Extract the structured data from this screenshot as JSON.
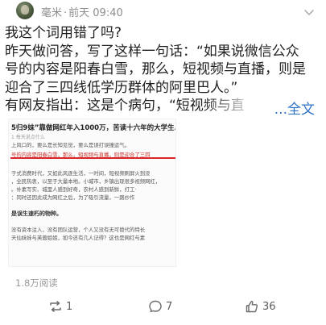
{
  "header": {
    "username": "毫米",
    "separator": "·",
    "time": "前天 09:40",
    "avatar_icon": "avatar"
  },
  "post": {
    "lines": [
      "我这个词用错了吗?",
      "昨天做问答，写了这样一句话：“如果说微信公众",
      "号的内容是阳春白雪，那么，短视频与直播，则是",
      "迎合了三四线低学历群体的阿里巴人。”",
      "有网友指出：这是个病句，“短视频与直"
    ],
    "fulltext_label": "...全文"
  },
  "article_image": {
    "headline": "5归9妹”靠做网红年入1000万，苦读十六年的大学生...",
    "sub": "1 每天说点什么",
    "lines": [
      "上风口的，要么是长知见觉，要么是误打误撞运气。",
      "号的内容是阳春白雪，那么，短视频与直播，则是迎合了三四",
      "于式消费时代，又如此风逐生活，一时间，短视频刷屏火到没",
      "，全民热衷，以至于大量本地。小城市，乡镇出现很多视频网红，",
      "。补素写实、城里人感到好奇，农村人感到新鲜，打工·",
      "：同时还因此成为网红之后，为了吸引流量，一路炒作",
      "是误生速朽的物种。",
      "没有资本注入，没有团队运营，个人又没有无可替代的特长",
      "天仙妹妹与芙蓉姐姐，如今还有几人记得？这也是网红与素"
    ],
    "bold_line": "是误生速朽的物种。"
  },
  "footer": {
    "reads": "1.8万阅读",
    "repost_count": "1",
    "comment_count": "7",
    "like_count": "36"
  },
  "colors": {
    "link": "#2f73c7",
    "highlight_red": "#d9262a",
    "meta_gray": "#8e8e8e"
  }
}
